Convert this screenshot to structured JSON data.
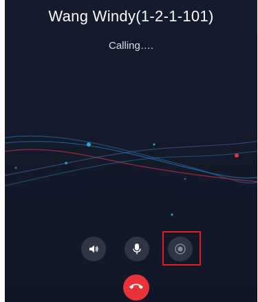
{
  "call": {
    "contact_name": "Wang Windy(1-2-1-101)",
    "status": "Calling…."
  },
  "controls": {
    "speaker_icon": "speaker-icon",
    "mic_icon": "microphone-icon",
    "record_icon": "record-icon",
    "hangup_icon": "phone-hangup-icon"
  },
  "colors": {
    "background": "#141a2b",
    "control_bg": "#2f3543",
    "hangup_red": "#e8333a",
    "highlight_red": "#e02020"
  }
}
